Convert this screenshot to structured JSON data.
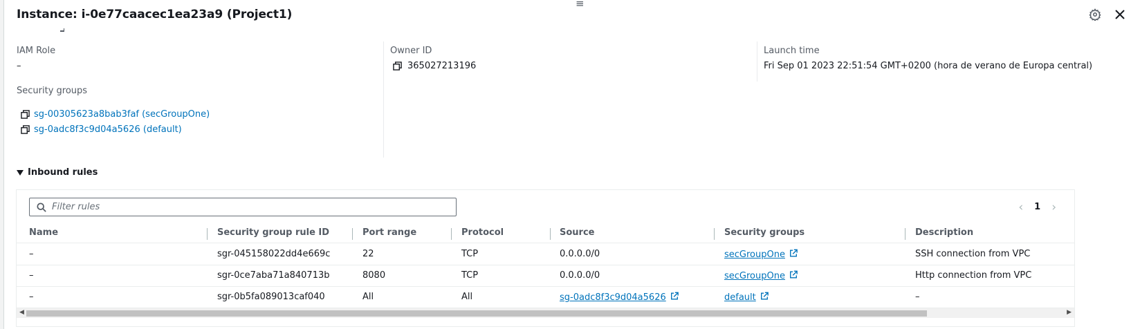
{
  "header": {
    "drag_handle": "≡",
    "title": "Instance: i-0e77caacec1ea23a9 (Project1)"
  },
  "details": {
    "iam_role": {
      "label": "IAM Role",
      "value": "–"
    },
    "owner_id": {
      "label": "Owner ID",
      "value": "365027213196"
    },
    "launch_time": {
      "label": "Launch time",
      "value": "Fri Sep 01 2023 22:51:54 GMT+0200 (hora de verano de Europa central)"
    },
    "security_groups": {
      "label": "Security groups",
      "items": [
        "sg-00305623a8bab3faf (secGroupOne)",
        "sg-0adc8f3c9d04a5626 (default)"
      ]
    }
  },
  "inbound": {
    "title": "Inbound rules",
    "filter_placeholder": "Filter rules",
    "page": "1",
    "columns": [
      "Name",
      "Security group rule ID",
      "Port range",
      "Protocol",
      "Source",
      "Security groups",
      "Description"
    ],
    "rows": [
      {
        "name": "–",
        "rule_id": "sgr-045158022dd4e669c",
        "port": "22",
        "protocol": "TCP",
        "source": "0.0.0.0/0",
        "source_link": false,
        "sg": "secGroupOne",
        "desc": "SSH connection from VPC"
      },
      {
        "name": "–",
        "rule_id": "sgr-0ce7aba71a840713b",
        "port": "8080",
        "protocol": "TCP",
        "source": "0.0.0.0/0",
        "source_link": false,
        "sg": "secGroupOne",
        "desc": "Http connection from VPC"
      },
      {
        "name": "–",
        "rule_id": "sgr-0b5fa089013caf040",
        "port": "All",
        "protocol": "All",
        "source": "sg-0adc8f3c9d04a5626",
        "source_link": true,
        "sg": "default",
        "desc": "–"
      }
    ]
  },
  "colors": {
    "link": "#0073bb",
    "text": "#16191f",
    "muted": "#545b64"
  }
}
